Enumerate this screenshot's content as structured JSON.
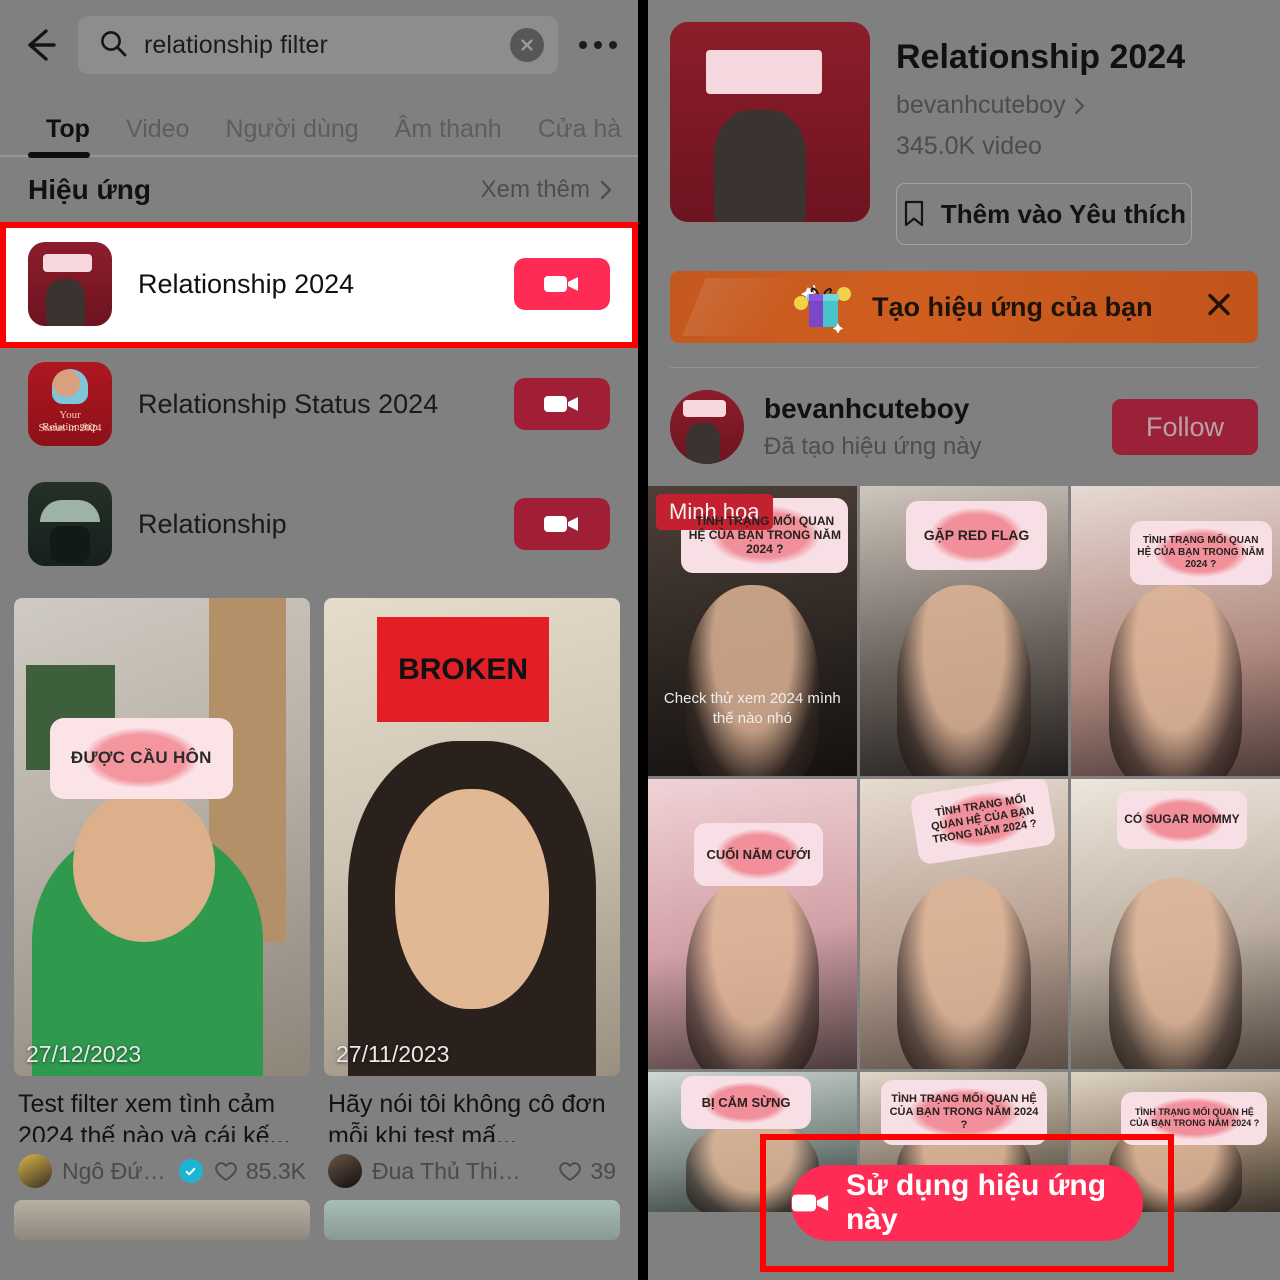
{
  "left": {
    "search": {
      "query": "relationship filter",
      "search_icon": "search-icon",
      "clear_icon": "clear-icon",
      "more_icon": "more-options-icon",
      "back_icon": "back-arrow-icon"
    },
    "tabs": [
      {
        "label": "Top",
        "active": true
      },
      {
        "label": "Video",
        "active": false
      },
      {
        "label": "Người dùng",
        "active": false
      },
      {
        "label": "Âm thanh",
        "active": false
      },
      {
        "label": "Cửa hà",
        "active": false
      }
    ],
    "section": {
      "title": "Hiệu ứng",
      "more_label": "Xem thêm"
    },
    "effects": [
      {
        "name": "Relationship 2024",
        "highlighted": true
      },
      {
        "name": "Relationship Status 2024",
        "highlighted": false
      },
      {
        "name": "Relationship",
        "highlighted": false
      }
    ],
    "effect_thumb_texts": {
      "relstatus_line1": "Your Relationship",
      "relstatus_line2": "Status in 2024"
    },
    "videos": [
      {
        "caption": "Test filter xem tình cảm 2024 thế nào và cái kế...",
        "author": "Ngô Đức D...",
        "verified": true,
        "likes": "85.3K",
        "date": "27/12/2023",
        "overlay_label": "ĐƯỢC CẦU HÔN"
      },
      {
        "caption": "Hãy nói tôi không cô đơn mỗi khi test mấ...",
        "author": "Đua Thủ Thiếu N...",
        "verified": false,
        "likes": "39",
        "date": "27/11/2023",
        "overlay_label": "BROKEN"
      }
    ]
  },
  "right": {
    "effect": {
      "title": "Relationship 2024",
      "author": "bevanhcuteboy",
      "video_count": "345.0K video",
      "favorite_label": "Thêm vào Yêu thích",
      "favorite_icon": "bookmark-icon"
    },
    "promo": {
      "text": "Tạo hiệu ứng của bạn",
      "close_icon": "close-icon",
      "gift_icon": "gift-icon"
    },
    "creator": {
      "name": "bevanhcuteboy",
      "subtitle": "Đã tạo hiệu ứng này",
      "follow_label": "Follow"
    },
    "grid": [
      {
        "badge": "Minh họa",
        "head_label": "TÌNH TRẠNG MỐI QUAN HỆ CỦA BẠN TRONG NĂM 2024 ?",
        "caption": "Check thử xem 2024 mình thế nào nhó"
      },
      {
        "badge": "",
        "head_label": "GẶP RED FLAG",
        "caption": ""
      },
      {
        "badge": "",
        "head_label": "TÌNH TRẠNG MỐI QUAN HỆ CỦA BẠN TRONG NĂM 2024 ?",
        "caption": ""
      },
      {
        "badge": "",
        "head_label": "CUỐI NĂM CƯỚI",
        "caption": ""
      },
      {
        "badge": "",
        "head_label": "TÌNH TRẠNG MỐI QUAN HỆ CỦA BẠN TRONG NĂM 2024 ?",
        "caption": ""
      },
      {
        "badge": "",
        "head_label": "CÓ SUGAR MOMMY",
        "caption": ""
      },
      {
        "badge": "",
        "head_label": "BỊ CẮM SỪNG",
        "caption": ""
      },
      {
        "badge": "",
        "head_label": "TÌNH TRẠNG MỐI QUAN HỆ CỦA BẠN TRONG NĂM 2024 ?",
        "caption": ""
      },
      {
        "badge": "",
        "head_label": "TÌNH TRẠNG MỐI QUAN HỆ CỦA BẠN TRONG NĂM 2024 ?",
        "caption": ""
      }
    ],
    "cta": {
      "label": "Sử dụng hiệu ứng này",
      "icon": "video-camera-icon"
    }
  },
  "colors": {
    "accent_pink": "#FE2C55",
    "accent_dim_red": "#9A2137",
    "highlight_box": "#FF0000",
    "promo_orange": "#CF5F20",
    "verified_blue": "#20B4D4",
    "dim_background": "#808080"
  }
}
